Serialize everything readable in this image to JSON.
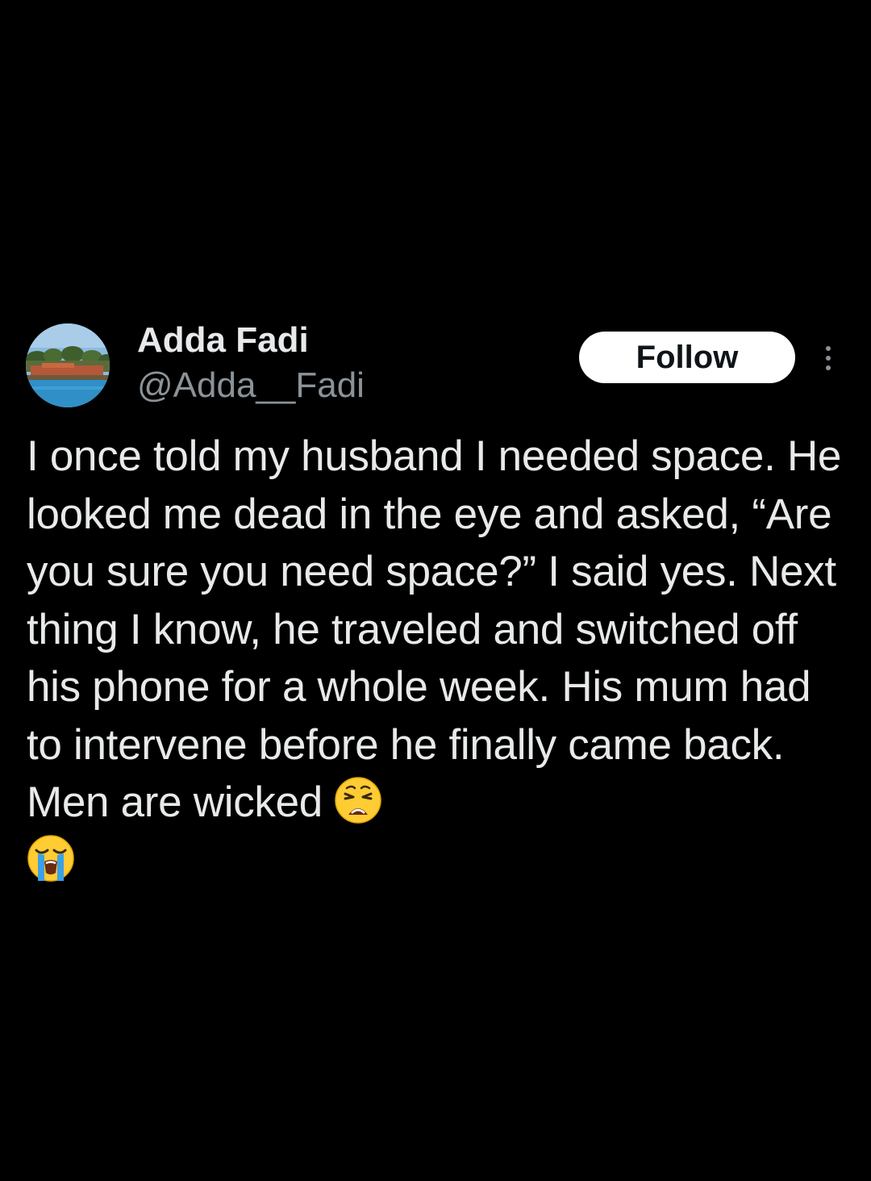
{
  "author": {
    "display_name": "Adda Fadi",
    "handle": "@Adda__Fadi",
    "avatar_icon": "landscape-avatar"
  },
  "actions": {
    "follow_label": "Follow",
    "more_icon": "more-vertical-icon"
  },
  "tweet": {
    "text": "I once told my husband I needed space. He looked me dead in the eye and asked, “Are you sure you need space?” I said yes. Next thing I know, he traveled and switched off his phone for a whole week. His mum had to intervene before he finally came back. Men are wicked",
    "emojis": [
      "weary-face-emoji",
      "loudly-crying-face-emoji"
    ]
  },
  "colors": {
    "background": "#000000",
    "primary_text": "#e7e9ea",
    "secondary_text": "#8b9298",
    "follow_bg": "#ffffff"
  }
}
